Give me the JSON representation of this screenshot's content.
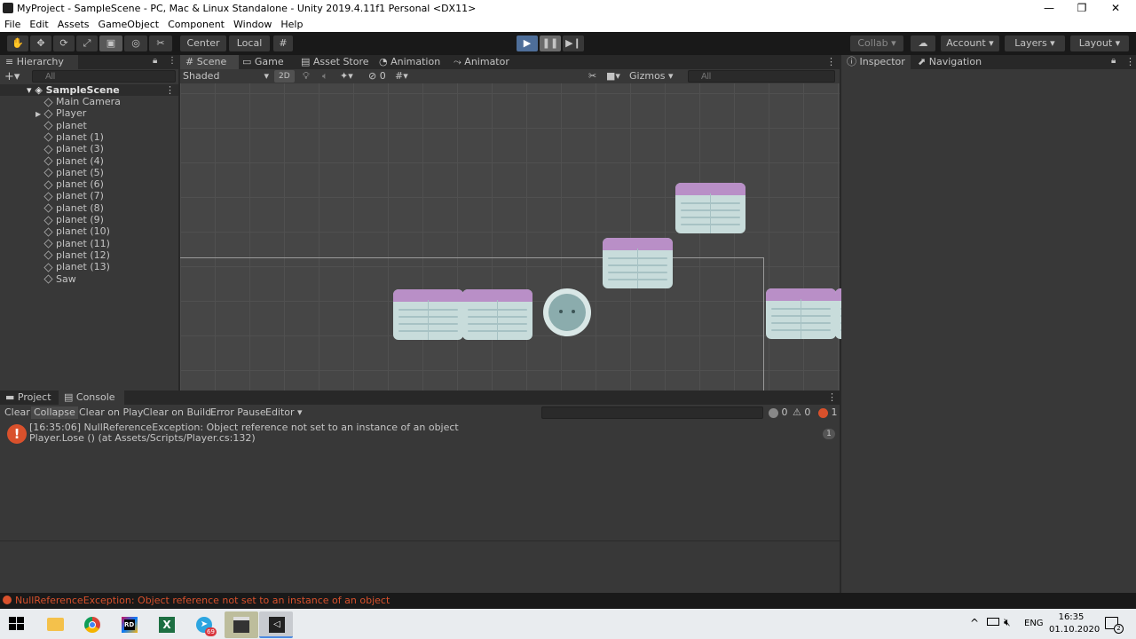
{
  "window": {
    "title": "MyProject - SampleScene - PC, Mac & Linux Standalone - Unity 2019.4.11f1 Personal <DX11>",
    "minimize": "—",
    "maximize": "❐",
    "close": "✕"
  },
  "menu": [
    "File",
    "Edit",
    "Assets",
    "GameObject",
    "Component",
    "Window",
    "Help"
  ],
  "toolbar": {
    "pivot": "Center",
    "space": "Local",
    "collab": "Collab",
    "account": "Account",
    "layers": "Layers",
    "layout": "Layout"
  },
  "hierarchy": {
    "tab": "Hierarchy",
    "search_placeholder": "All",
    "scene": "SampleScene",
    "items": [
      "Main Camera",
      "Player",
      "planet",
      "planet (1)",
      "planet (3)",
      "planet (4)",
      "planet (5)",
      "planet (6)",
      "planet (7)",
      "planet (8)",
      "planet (9)",
      "planet (10)",
      "planet (11)",
      "planet (12)",
      "planet (13)",
      "Saw"
    ]
  },
  "scene": {
    "tabs": [
      "Scene",
      "Game",
      "Asset Store",
      "Animation",
      "Animator"
    ],
    "shading": "Shaded",
    "mode2d": "2D",
    "hidden_count": "0",
    "gizmos": "Gizmos",
    "search_placeholder": "All"
  },
  "inspector": {
    "tabs": [
      "Inspector",
      "Navigation"
    ]
  },
  "console": {
    "tabs": [
      "Project",
      "Console"
    ],
    "buttons": [
      "Clear",
      "Collapse",
      "Clear on Play",
      "Clear on Build",
      "Error Pause"
    ],
    "editor_dropdown": "Editor",
    "log_count": "0",
    "warn_count": "0",
    "error_count": "1",
    "entry_line1": "[16:35:06] NullReferenceException: Object reference not set to an instance of an object",
    "entry_line2": "Player.Lose () (at Assets/Scripts/Player.cs:132)",
    "entry_count": "1"
  },
  "status": {
    "message": "NullReferenceException: Object reference not set to an instance of an object"
  },
  "taskbar": {
    "lang": "ENG",
    "time": "16:35",
    "date": "01.10.2020",
    "notif_count": "2",
    "badge": "69"
  },
  "colors": {
    "accent": "#4e6e99",
    "error": "#d9512c"
  }
}
